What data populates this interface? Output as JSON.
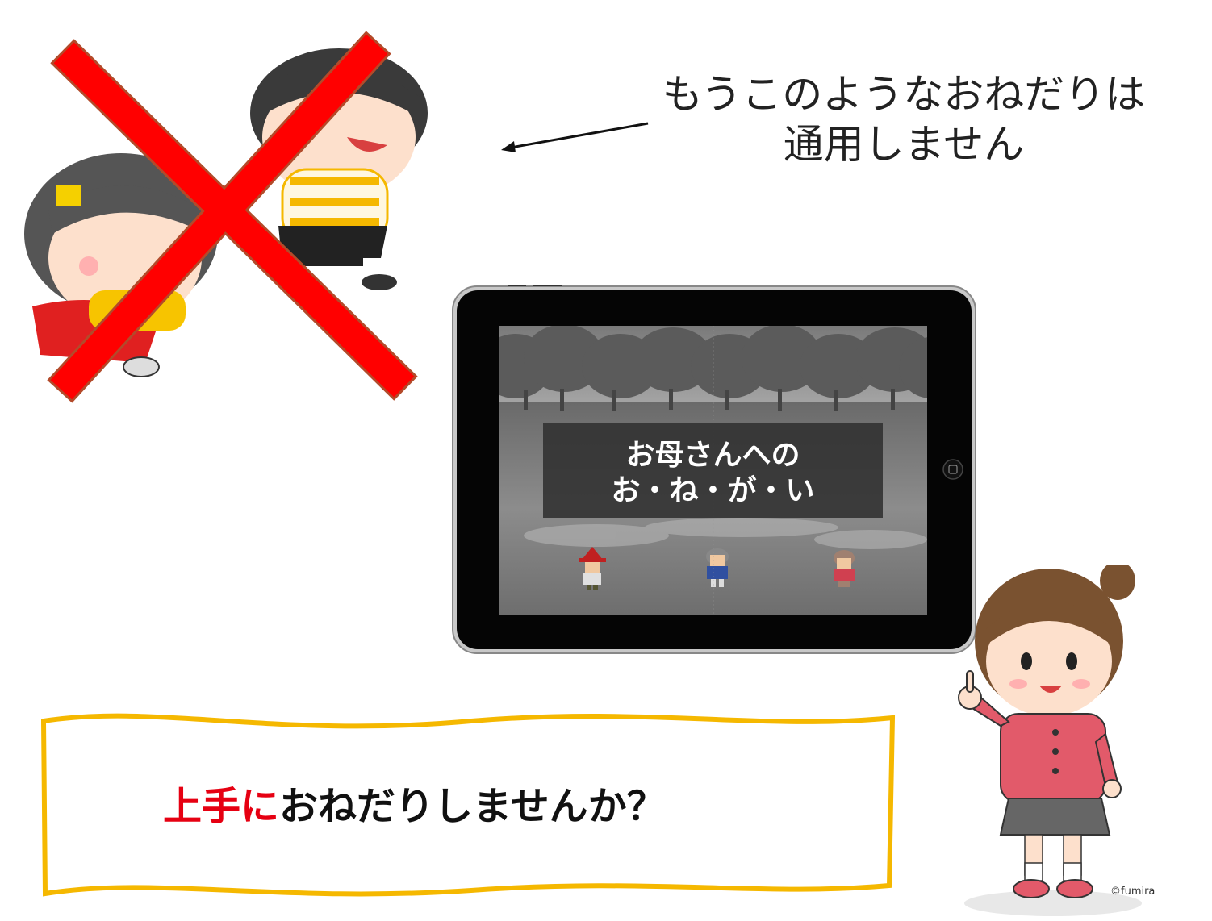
{
  "callout": {
    "line1": "もうこのようなおねだりは",
    "line2": "通用しません"
  },
  "tablet": {
    "screen_title_line1": "お母さんへの",
    "screen_title_line2": "お・ね・が・い"
  },
  "banner": {
    "highlight": "上手に",
    "rest": "おねだりしませんか？"
  },
  "credit": "©fumira",
  "colors": {
    "cross": "#ff0000",
    "banner_border": "#f5b800",
    "highlight": "#e60012"
  }
}
